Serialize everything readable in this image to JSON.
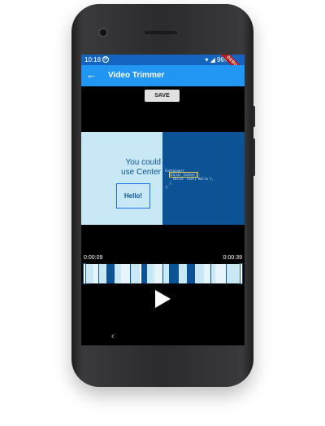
{
  "status_bar": {
    "time": "10:18",
    "battery": "96%",
    "debug_banner": "DEBUG"
  },
  "app_bar": {
    "back_icon": "arrow-back-icon",
    "title": "Video Trimmer"
  },
  "save_button": {
    "label": "SAVE"
  },
  "video_preview": {
    "caption_line1": "You could",
    "caption_line2": "use Center",
    "hello_text": "Hello!",
    "code_line1": "Container(",
    "code_line2": "child: Center(",
    "code_line3": "child: Text('Hello'),",
    "code_line4": "),",
    "code_line5": ");"
  },
  "trimmer": {
    "start_time": "0:00:09",
    "end_time": "0:00:39",
    "thumbnail_count": 10
  },
  "controls": {
    "play_icon": "play-icon"
  },
  "nav": {
    "back_icon": "nav-back-icon"
  }
}
